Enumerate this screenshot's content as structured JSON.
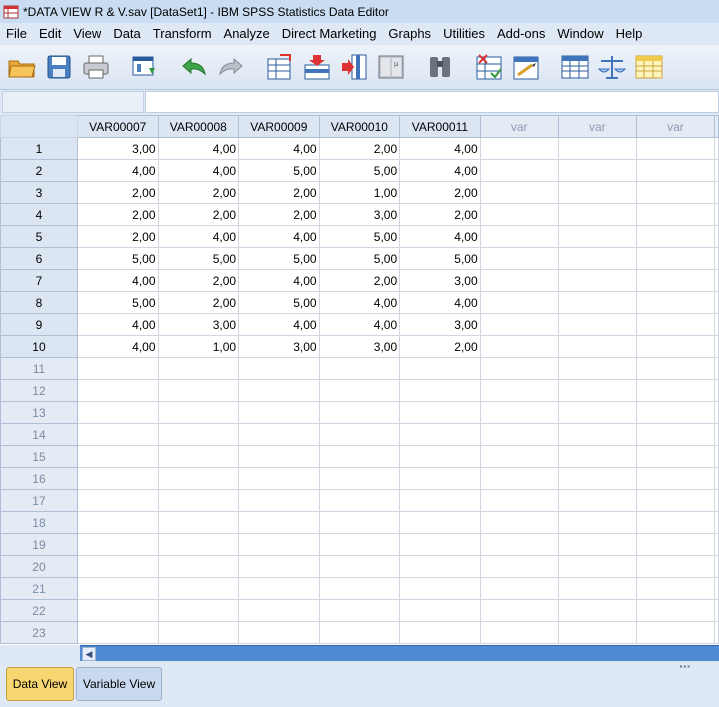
{
  "window": {
    "title": "*DATA VIEW R & V.sav [DataSet1] - IBM SPSS Statistics Data Editor"
  },
  "menu": [
    {
      "label": "File"
    },
    {
      "label": "Edit"
    },
    {
      "label": "View"
    },
    {
      "label": "Data"
    },
    {
      "label": "Transform"
    },
    {
      "label": "Analyze"
    },
    {
      "label": "Direct Marketing"
    },
    {
      "label": "Graphs"
    },
    {
      "label": "Utilities"
    },
    {
      "label": "Add-ons"
    },
    {
      "label": "Window"
    },
    {
      "label": "Help"
    }
  ],
  "toolbar": {
    "icons": [
      "open-folder-icon",
      "save-icon",
      "print-icon",
      "dialog-recall-icon",
      "undo-icon",
      "redo-icon",
      "go-to-case-icon",
      "insert-cases-icon",
      "insert-variable-icon",
      "split-file-icon",
      "find-icon",
      "select-cases-icon",
      "value-labels-icon",
      "use-variable-sets-icon",
      "weight-cases-icon",
      "show-all-variables-icon"
    ]
  },
  "editor": {
    "cell_reference": "",
    "cell_value": ""
  },
  "grid": {
    "columns": [
      "VAR00007",
      "VAR00008",
      "VAR00009",
      "VAR00010",
      "VAR00011",
      "var",
      "var",
      "var"
    ],
    "rows": [
      {
        "num": "1",
        "values": [
          "3,00",
          "4,00",
          "4,00",
          "2,00",
          "4,00"
        ]
      },
      {
        "num": "2",
        "values": [
          "4,00",
          "4,00",
          "5,00",
          "5,00",
          "4,00"
        ]
      },
      {
        "num": "3",
        "values": [
          "2,00",
          "2,00",
          "2,00",
          "1,00",
          "2,00"
        ]
      },
      {
        "num": "4",
        "values": [
          "2,00",
          "2,00",
          "2,00",
          "3,00",
          "2,00"
        ]
      },
      {
        "num": "5",
        "values": [
          "2,00",
          "4,00",
          "4,00",
          "5,00",
          "4,00"
        ]
      },
      {
        "num": "6",
        "values": [
          "5,00",
          "5,00",
          "5,00",
          "5,00",
          "5,00"
        ]
      },
      {
        "num": "7",
        "values": [
          "4,00",
          "2,00",
          "4,00",
          "2,00",
          "3,00"
        ]
      },
      {
        "num": "8",
        "values": [
          "5,00",
          "2,00",
          "5,00",
          "4,00",
          "4,00"
        ]
      },
      {
        "num": "9",
        "values": [
          "4,00",
          "3,00",
          "4,00",
          "4,00",
          "3,00"
        ]
      },
      {
        "num": "10",
        "values": [
          "4,00",
          "1,00",
          "3,00",
          "3,00",
          "2,00"
        ]
      }
    ],
    "empty_rows": [
      "11",
      "12",
      "13",
      "14",
      "15",
      "16",
      "17",
      "18",
      "19",
      "20",
      "21",
      "22",
      "23"
    ]
  },
  "scrollbar": {
    "left_arrow": "◀",
    "grip": "▪▪▪"
  },
  "tabs": {
    "data_view": "Data View",
    "variable_view": "Variable View"
  },
  "colors": {
    "active_tab": "#f7d570",
    "header_bg": "#dce6f3",
    "scrollbar": "#4e8bd4"
  }
}
